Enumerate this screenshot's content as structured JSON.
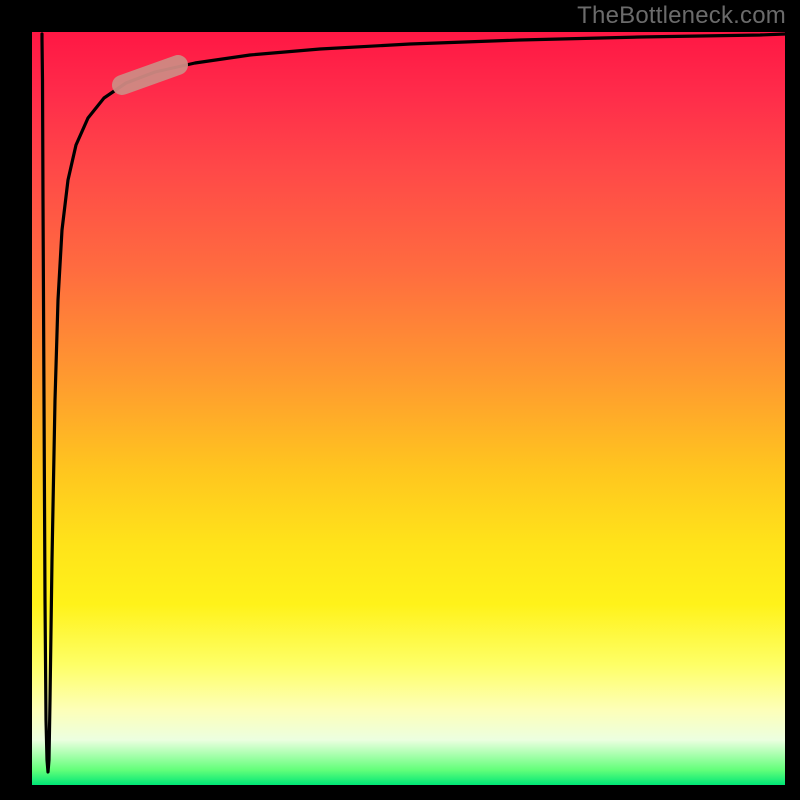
{
  "watermark": "TheBottleneck.com",
  "colors": {
    "background": "#000000",
    "gradient_top": "#ff1744",
    "gradient_mid1": "#ff9a2f",
    "gradient_mid2": "#ffe31a",
    "gradient_pale": "#fdffb8",
    "gradient_bottom": "#00e676",
    "curve": "#000000",
    "marker": "#cf8a83",
    "watermark_text": "#6b6b6b"
  },
  "chart_data": {
    "type": "line",
    "title": "",
    "xlabel": "",
    "ylabel": "",
    "xlim": [
      0,
      100
    ],
    "ylim": [
      0,
      100
    ],
    "grid": false,
    "legend": false,
    "annotations": [
      {
        "kind": "watermark",
        "text": "TheBottleneck.com",
        "position": "top-right"
      },
      {
        "kind": "segment-highlight",
        "x_range": [
          12,
          20
        ],
        "color": "#cf8a83"
      }
    ],
    "background_gradient": {
      "direction": "vertical",
      "stops": [
        {
          "pos": 0.0,
          "color": "#ff1744"
        },
        {
          "pos": 0.32,
          "color": "#ff6d3f"
        },
        {
          "pos": 0.58,
          "color": "#ffc51f"
        },
        {
          "pos": 0.76,
          "color": "#fff21a"
        },
        {
          "pos": 0.9,
          "color": "#fdffb8"
        },
        {
          "pos": 1.0,
          "color": "#00e676"
        }
      ]
    },
    "series": [
      {
        "name": "curve",
        "x": [
          1.0,
          1.1,
          1.2,
          1.4,
          1.6,
          1.8,
          2.0,
          2.2,
          2.5,
          3.0,
          3.6,
          4.5,
          6.0,
          8.0,
          11.0,
          15.0,
          22.0,
          32.0,
          45.0,
          62.0,
          80.0,
          95.0,
          100.0
        ],
        "y": [
          99.5,
          80.0,
          20.0,
          1.5,
          3.0,
          22.0,
          48.0,
          63.0,
          73.0,
          80.0,
          85.0,
          88.5,
          91.0,
          92.5,
          93.5,
          94.3,
          95.0,
          95.5,
          95.8,
          96.0,
          96.2,
          96.3,
          96.4
        ]
      }
    ]
  }
}
